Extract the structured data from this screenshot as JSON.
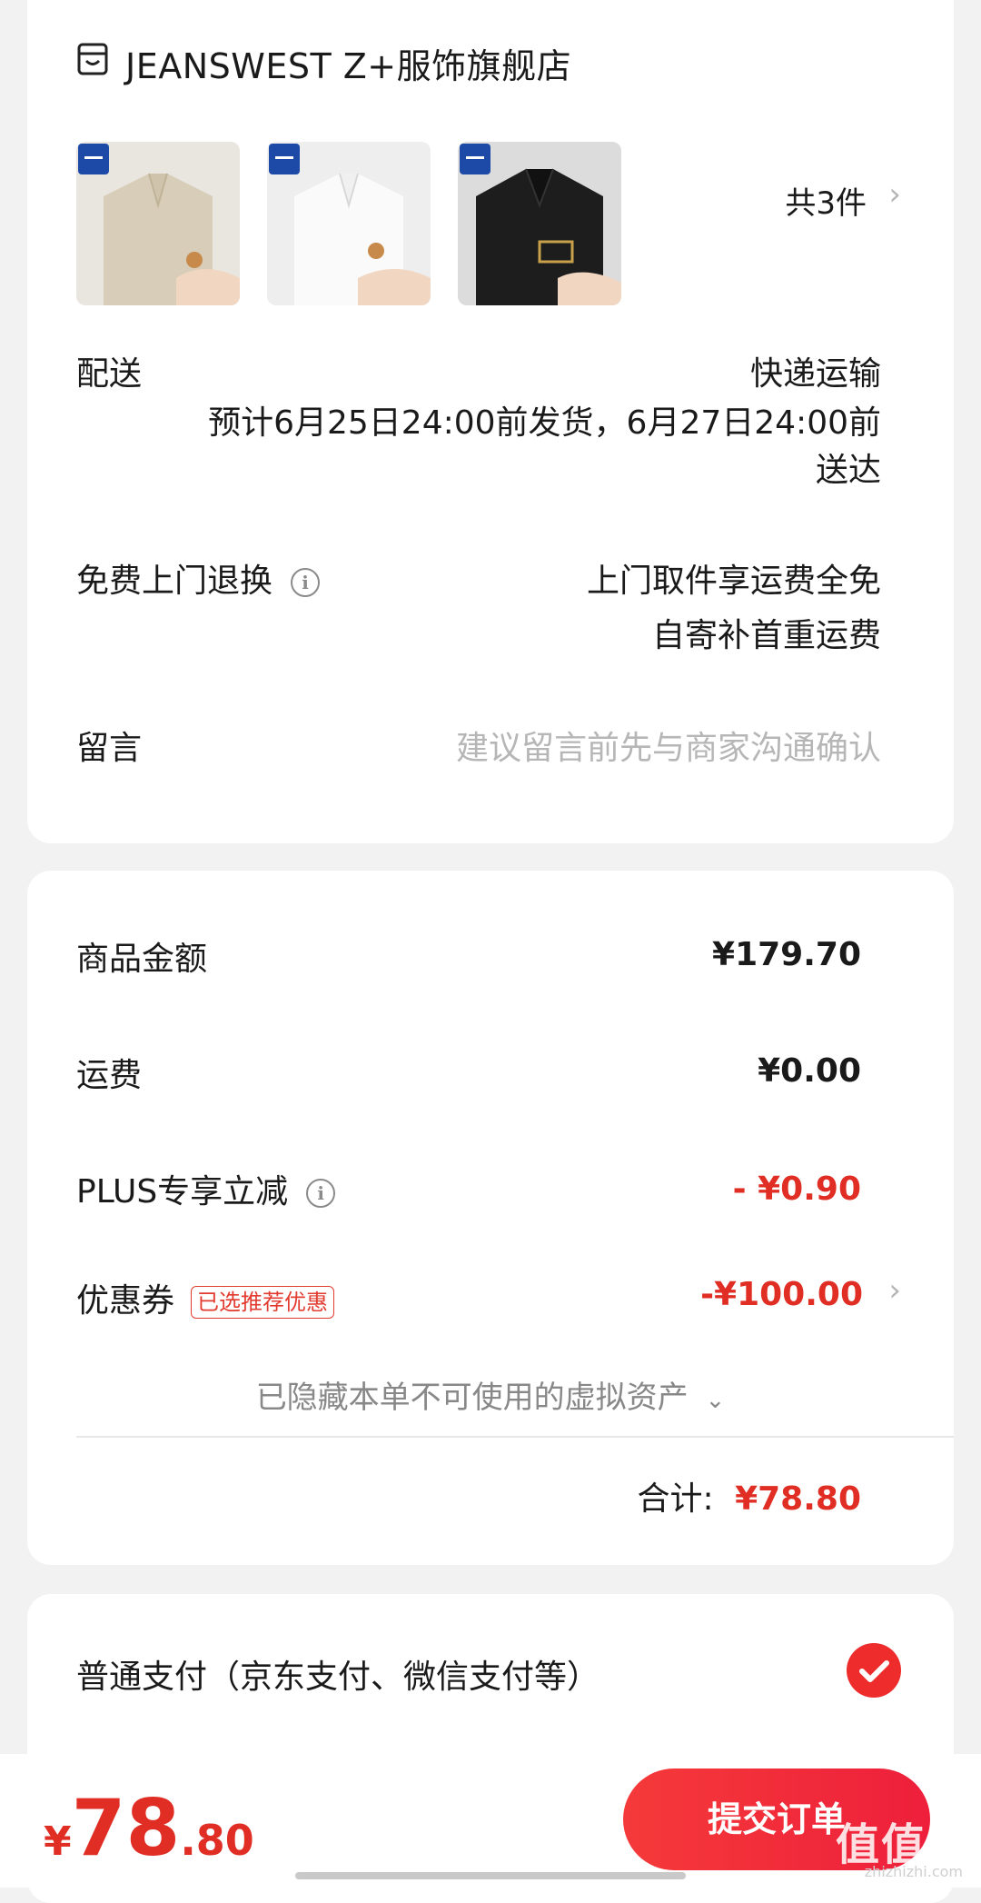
{
  "store": {
    "name": "JEANSWEST Z+服饰旗舰店",
    "icon": "store-icon"
  },
  "products": {
    "count_label": "共3件",
    "items": [
      {
        "name": "polo-khaki",
        "color": "#d8cdb8"
      },
      {
        "name": "polo-white",
        "color": "#f4f4f4"
      },
      {
        "name": "polo-black",
        "color": "#1d1d1d"
      }
    ]
  },
  "delivery": {
    "label": "配送",
    "method": "快递运输",
    "estimate_line1": "预计6月25日24:00前发货，6月27日24:00前",
    "estimate_line2": "送达"
  },
  "returns": {
    "label": "免费上门退换",
    "line1": "上门取件享运费全免",
    "line2": "自寄补首重运费"
  },
  "message": {
    "label": "留言",
    "placeholder": "建议留言前先与商家沟通确认"
  },
  "price": {
    "goods_label": "商品金额",
    "goods_value": "¥179.70",
    "shipping_label": "运费",
    "shipping_value": "¥0.00",
    "plus_label": "PLUS专享立减",
    "plus_value": "- ¥0.90",
    "coupon_label": "优惠券",
    "coupon_badge": "已选推荐优惠",
    "coupon_value": "-¥100.00",
    "hidden_assets": "已隐藏本单不可使用的虚拟资产",
    "total_label": "合计:",
    "total_value": "¥78.80"
  },
  "payment": {
    "option": "普通支付（京东支付、微信支付等）",
    "selected": true
  },
  "bottom": {
    "currency": "¥",
    "amount_int": "78",
    "amount_dec": ".80",
    "submit": "提交订单",
    "watermark": "值值值",
    "watermark_sub": "zhizhizhi.com"
  },
  "colors": {
    "accent": "#e02e24",
    "button": "#f2303a"
  }
}
